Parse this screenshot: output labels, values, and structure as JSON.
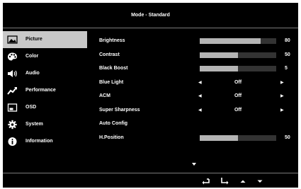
{
  "title": "Mode - Standard",
  "sidebar": {
    "items": [
      {
        "label": "Picture",
        "icon": "picture-icon",
        "active": true
      },
      {
        "label": "Color",
        "icon": "color-palette-icon"
      },
      {
        "label": "Audio",
        "icon": "speaker-icon"
      },
      {
        "label": "Performance",
        "icon": "performance-chart-icon"
      },
      {
        "label": "OSD",
        "icon": "osd-window-icon"
      },
      {
        "label": "System",
        "icon": "gear-icon"
      },
      {
        "label": "Information",
        "icon": "info-icon"
      }
    ]
  },
  "settings": {
    "brightness": {
      "label": "Brightness",
      "value": "80",
      "level": 80
    },
    "contrast": {
      "label": "Contrast",
      "value": "50",
      "level": 50
    },
    "black_boost": {
      "label": "Black Boost",
      "value": "5",
      "level": 50
    },
    "blue_light": {
      "label": "Blue Light",
      "value": "Off"
    },
    "acm": {
      "label": "ACM",
      "value": "Off"
    },
    "super_sharpness": {
      "label": "Super Sharpness",
      "value": "Off"
    },
    "auto_config": {
      "label": "Auto Config"
    },
    "h_position": {
      "label": "H.Position",
      "value": "50",
      "level": 50
    }
  },
  "colors": {
    "background": "#000000",
    "bar_fill": "#b4b4b4",
    "bar_track": "#333333",
    "active_item": "#c8c8c8"
  },
  "keys": [
    "back-key-icon",
    "enter-key-icon",
    "up-key-icon",
    "down-key-icon"
  ]
}
